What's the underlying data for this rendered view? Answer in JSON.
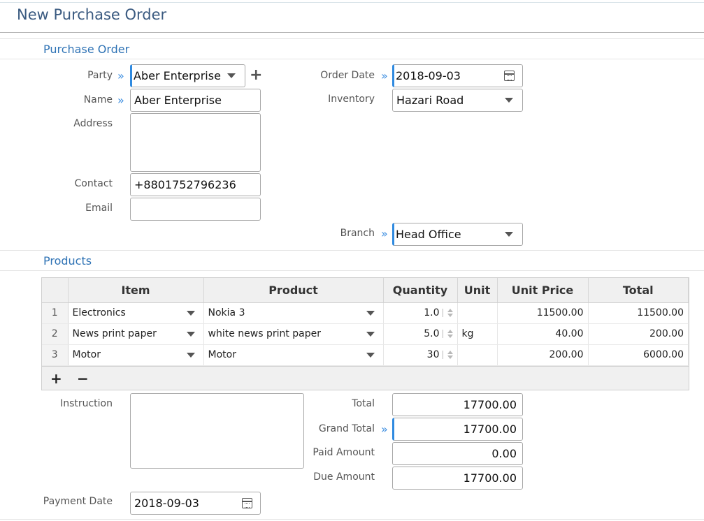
{
  "page": {
    "title": "New Purchase Order"
  },
  "sections": {
    "purchase_order": "Purchase Order",
    "products": "Products"
  },
  "form": {
    "party": {
      "label": "Party",
      "value": "Aber Enterprise"
    },
    "name": {
      "label": "Name",
      "value": "Aber Enterprise"
    },
    "address": {
      "label": "Address",
      "value": ""
    },
    "contact": {
      "label": "Contact",
      "value": "+8801752796236"
    },
    "email": {
      "label": "Email",
      "value": ""
    },
    "order_date": {
      "label": "Order Date",
      "value": "2018-09-03"
    },
    "inventory": {
      "label": "Inventory",
      "value": "Hazari Road"
    },
    "branch": {
      "label": "Branch",
      "value": "Head Office"
    }
  },
  "products_table": {
    "columns": [
      "Item",
      "Product",
      "Quantity",
      "Unit",
      "Unit Price",
      "Total"
    ],
    "rows": [
      {
        "no": "1",
        "item": "Electronics",
        "product": "Nokia 3",
        "quantity": "1.0",
        "unit": "",
        "unit_price": "11500.00",
        "total": "11500.00"
      },
      {
        "no": "2",
        "item": "News print paper",
        "product": "white news print paper",
        "quantity": "5.0",
        "unit": "kg",
        "unit_price": "40.00",
        "total": "200.00"
      },
      {
        "no": "3",
        "item": "Motor",
        "product": "Motor",
        "quantity": "30",
        "unit": "",
        "unit_price": "200.00",
        "total": "6000.00"
      }
    ],
    "add_label": "+",
    "remove_label": "−"
  },
  "summary": {
    "instruction": {
      "label": "Instruction",
      "value": ""
    },
    "total": {
      "label": "Total",
      "value": "17700.00"
    },
    "grand_total": {
      "label": "Grand Total",
      "value": "17700.00"
    },
    "paid_amount": {
      "label": "Paid Amount",
      "value": "0.00"
    },
    "due_amount": {
      "label": "Due Amount",
      "value": "17700.00"
    },
    "payment_date": {
      "label": "Payment Date",
      "value": "2018-09-03"
    }
  },
  "icons": {
    "required_marker": "»",
    "add_party": "+",
    "accent_color": "#2f8ae0",
    "title_color": "#3a5a80",
    "section_color": "#2f73b5"
  }
}
